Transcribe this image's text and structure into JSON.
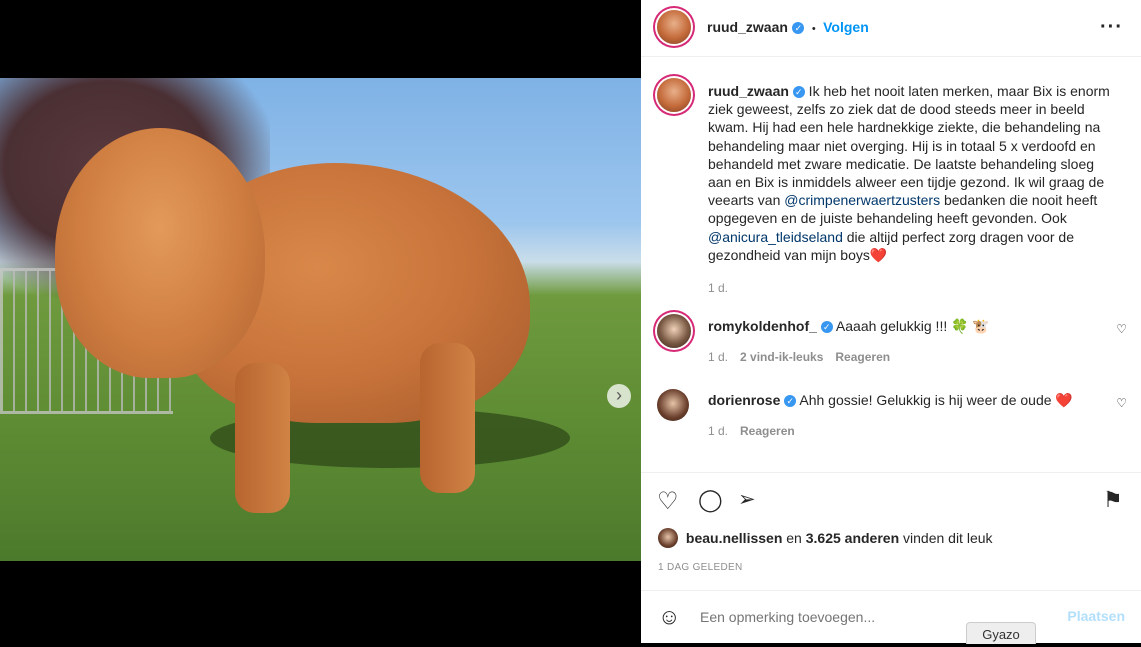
{
  "post": {
    "author": "ruud_zwaan",
    "follow_label": "Volgen",
    "separator": "•",
    "caption_part1": " Ik heb het nooit laten merken, maar Bix is enorm ziek geweest, zelfs zo ziek dat de dood steeds meer in beeld kwam. Hij had een hele hardnekkige ziekte, die behandeling na behandeling maar niet overging. Hij is in totaal 5 x verdoofd en behandeld met zware medicatie. De laatste behandeling sloeg aan en Bix is inmiddels alweer een tijdje gezond. Ik wil graag de veearts van ",
    "mention1": "@crimpenerwaertzusters",
    "caption_part2": " bedanken die nooit heeft opgegeven en de juiste behandeling heeft gevonden. Ook ",
    "mention2": "@anicura_tleidseland",
    "caption_part3": " die altijd perfect zorg dragen voor de gezondheid van mijn boys❤️",
    "caption_age": "1 d."
  },
  "comments": [
    {
      "user": "romykoldenhof_",
      "text": "Aaaah gelukkig !!! 🍀 🐮",
      "age": "1 d.",
      "likes": "2 vind-ik-leuks",
      "reply": "Reageren"
    },
    {
      "user": "dorienrose",
      "text": "Ahh gossie! Gelukkig is hij weer de oude ❤️",
      "age": "1 d.",
      "reply": "Reageren"
    }
  ],
  "likes": {
    "user": "beau.nellissen",
    "connector": "en",
    "count": "3.625 anderen",
    "suffix": "vinden dit leuk"
  },
  "date": "1 DAG GELEDEN",
  "add_comment": {
    "placeholder": "Een opmerking toevoegen...",
    "post_label": "Plaatsen"
  },
  "icons": {
    "heart": "heart-icon",
    "comment": "comment-icon",
    "share": "share-icon",
    "save": "bookmark-icon",
    "emoji": "emoji-icon",
    "more": "more-icon"
  },
  "colors": {
    "accent": "#0095f6",
    "verified": "#3897f0",
    "post_disabled": "#b2dffc"
  },
  "gyazo_label": "Gyazo"
}
